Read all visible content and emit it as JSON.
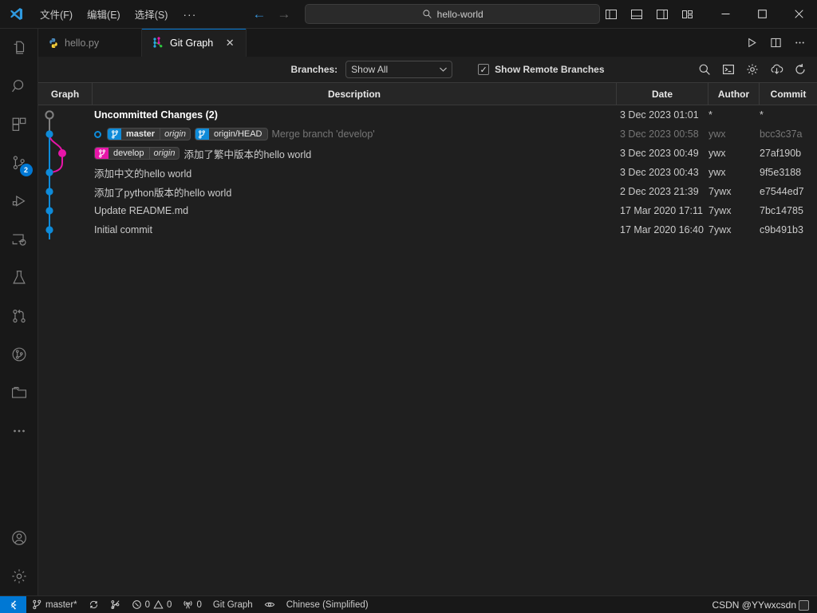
{
  "titlebar": {
    "logo_icon": "vscode-logo-icon",
    "menus": [
      {
        "label": "文件(F)",
        "name": "menu-file"
      },
      {
        "label": "编辑(E)",
        "name": "menu-edit"
      },
      {
        "label": "选择(S)",
        "name": "menu-selection"
      },
      {
        "label": "···",
        "name": "menu-more"
      }
    ],
    "nav": {
      "back_icon": "arrow-left-icon",
      "forward_icon": "arrow-right-icon"
    },
    "command_center": {
      "icon": "search-icon",
      "value": "hello-world",
      "placeholder": "Search"
    },
    "layout_icons": [
      {
        "name": "toggle-primary-sidebar-icon"
      },
      {
        "name": "toggle-panel-icon"
      },
      {
        "name": "toggle-secondary-sidebar-icon"
      },
      {
        "name": "customize-layout-icon"
      }
    ],
    "window_controls": [
      {
        "name": "minimize-button",
        "glyph": "—"
      },
      {
        "name": "maximize-button",
        "glyph": "□"
      },
      {
        "name": "close-button",
        "glyph": "✕"
      }
    ]
  },
  "activitybar": {
    "items": [
      {
        "name": "activitybar-explorer",
        "icon": "files-icon",
        "active": false
      },
      {
        "name": "activitybar-search",
        "icon": "search-icon",
        "active": false
      },
      {
        "name": "activitybar-extensions",
        "icon": "extensions-icon",
        "active": false
      },
      {
        "name": "activitybar-source-control",
        "icon": "source-control-icon",
        "active": false,
        "badge": "2"
      },
      {
        "name": "activitybar-run-debug",
        "icon": "run-and-debug-icon",
        "active": false
      },
      {
        "name": "activitybar-remote-explorer",
        "icon": "remote-explorer-icon",
        "active": false
      },
      {
        "name": "activitybar-testing",
        "icon": "beaker-icon",
        "active": false
      },
      {
        "name": "activitybar-pull-requests",
        "icon": "git-pull-request-icon",
        "active": false
      },
      {
        "name": "activitybar-git-graph",
        "icon": "git-graph-circle-icon",
        "active": false
      },
      {
        "name": "activitybar-project-manager",
        "icon": "folder-icon",
        "active": false
      },
      {
        "name": "activitybar-additional-views",
        "icon": "ellipsis-icon",
        "active": false
      }
    ],
    "bottom": [
      {
        "name": "activitybar-accounts",
        "icon": "account-icon"
      },
      {
        "name": "activitybar-settings",
        "icon": "gear-icon"
      }
    ]
  },
  "tabs": [
    {
      "label": "hello.py",
      "icon": "python-file-icon",
      "active": false,
      "name": "tab-hello-py"
    },
    {
      "label": "Git Graph",
      "icon": "git-graph-icon",
      "active": true,
      "name": "tab-git-graph",
      "close_glyph": "✕"
    }
  ],
  "editor_actions": [
    {
      "name": "run-python-file-button",
      "icon": "play-icon"
    },
    {
      "name": "split-editor-right-button",
      "icon": "split-editor-icon"
    },
    {
      "name": "more-actions-button",
      "icon": "ellipsis-icon"
    }
  ],
  "gitgraph": {
    "branches_label": "Branches:",
    "branches_value": "Show All",
    "branches_options": [
      "Show All"
    ],
    "show_remote_branches_label": "Show Remote Branches",
    "show_remote_branches_checked": true,
    "checkmark": "✓",
    "toolbar_icons": [
      {
        "name": "find-commit-button",
        "icon": "search-icon"
      },
      {
        "name": "open-terminal-button",
        "icon": "terminal-icon"
      },
      {
        "name": "repository-settings-button",
        "icon": "gear-icon"
      },
      {
        "name": "fetch-from-remotes-button",
        "icon": "cloud-download-icon"
      },
      {
        "name": "refresh-button",
        "icon": "refresh-icon"
      }
    ],
    "columns": [
      "Graph",
      "Description",
      "Date",
      "Author",
      "Commit"
    ],
    "rows": [
      {
        "description": "Uncommitted Changes (2)",
        "uncommitted": true,
        "dim": false,
        "refs": [],
        "head": false,
        "date": "3 Dec 2023 01:01",
        "author": "*",
        "commit": "*"
      },
      {
        "description": "Merge branch 'develop'",
        "uncommitted": false,
        "dim": true,
        "head": true,
        "refs": [
          {
            "color": "blue",
            "name": "master",
            "remote": "origin",
            "bold": true
          },
          {
            "color": "blue",
            "name": "origin/HEAD",
            "remote": "",
            "bold": false
          }
        ],
        "date": "3 Dec 2023 00:58",
        "author": "ywx",
        "commit": "bcc3c37a"
      },
      {
        "description": "添加了繁中版本的hello world",
        "uncommitted": false,
        "dim": false,
        "head": false,
        "refs": [
          {
            "color": "pink",
            "name": "develop",
            "remote": "origin",
            "bold": false
          }
        ],
        "date": "3 Dec 2023 00:49",
        "author": "ywx",
        "commit": "27af190b"
      },
      {
        "description": "添加中文的hello world",
        "uncommitted": false,
        "dim": false,
        "head": false,
        "refs": [],
        "date": "3 Dec 2023 00:43",
        "author": "ywx",
        "commit": "9f5e3188"
      },
      {
        "description": "添加了python版本的hello world",
        "uncommitted": false,
        "dim": false,
        "head": false,
        "refs": [],
        "date": "2 Dec 2023 21:39",
        "author": "7ywx",
        "commit": "e7544ed7"
      },
      {
        "description": "Update README.md",
        "uncommitted": false,
        "dim": false,
        "head": false,
        "refs": [],
        "date": "17 Mar 2020 17:11",
        "author": "7ywx",
        "commit": "7bc14785"
      },
      {
        "description": "Initial commit",
        "uncommitted": false,
        "dim": false,
        "head": false,
        "refs": [],
        "date": "17 Mar 2020 16:40",
        "author": "7ywx",
        "commit": "c9b491b3"
      }
    ],
    "colors": {
      "branch_master": "#0e8bd9",
      "branch_develop": "#e715a8",
      "uncommitted_node": "#808080"
    }
  },
  "statusbar": {
    "remote_icon": "remote-window-icon",
    "items": [
      {
        "name": "status-branch",
        "icon": "git-branch-icon",
        "label": "master*"
      },
      {
        "name": "status-sync",
        "icon": "sync-icon",
        "label": ""
      },
      {
        "name": "status-publish-branch",
        "icon": "git-compare-icon",
        "label": ""
      },
      {
        "name": "status-problems",
        "icon": "error-warning-icon",
        "label": "0 0",
        "errors": "0",
        "warnings": "0"
      },
      {
        "name": "status-ports",
        "icon": "radio-tower-icon",
        "label": "0"
      },
      {
        "name": "status-git-graph",
        "icon": "",
        "label": "Git Graph"
      },
      {
        "name": "status-watch",
        "icon": "eye-icon",
        "label": ""
      },
      {
        "name": "status-language-pack",
        "icon": "",
        "label": "Chinese (Simplified)"
      }
    ],
    "watermark": "CSDN @YYwxcsdn"
  }
}
